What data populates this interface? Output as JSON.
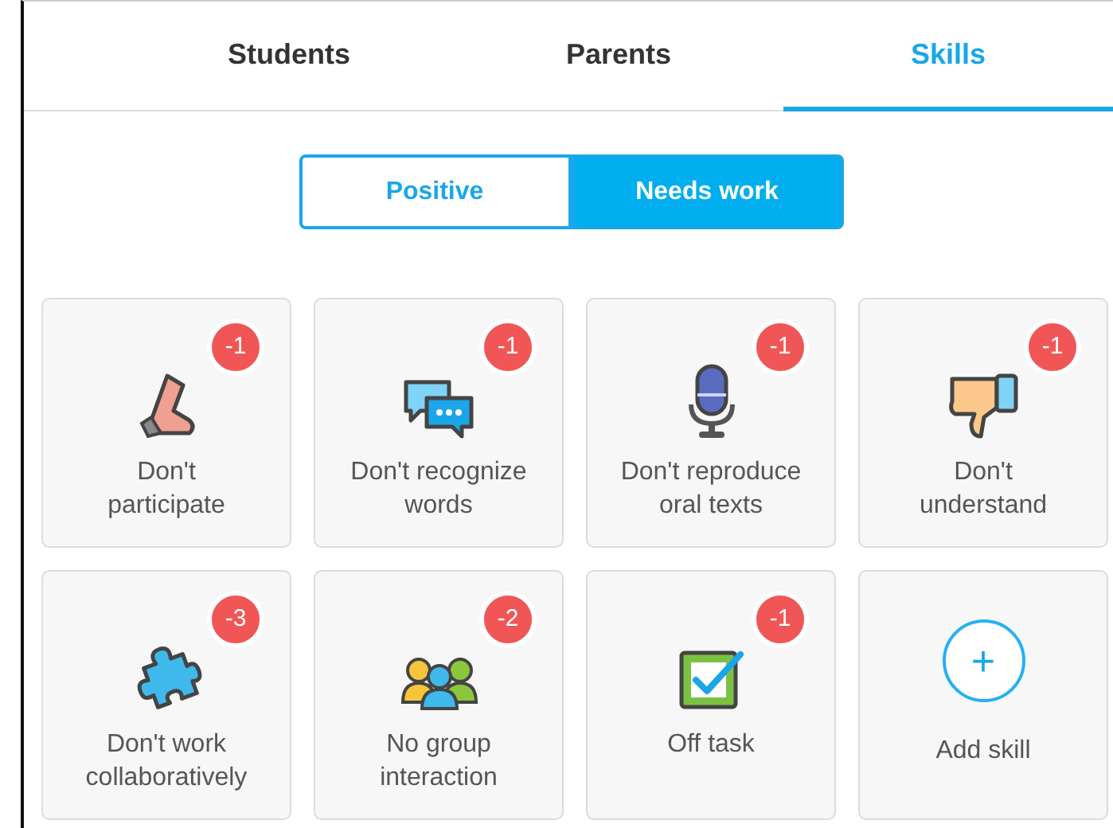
{
  "tabs": [
    {
      "label": "Students",
      "selected": false
    },
    {
      "label": "Parents",
      "selected": false
    },
    {
      "label": "Skills",
      "selected": true
    }
  ],
  "toggle": [
    {
      "label": "Positive",
      "selected": false
    },
    {
      "label": "Needs work",
      "selected": true
    }
  ],
  "tiles": [
    {
      "kind": "skill",
      "label": "Don't\nparticipate",
      "badge": "-1"
    },
    {
      "kind": "skill",
      "label": "Don't recognize\nwords",
      "badge": "-1"
    },
    {
      "kind": "skill",
      "label": "Don't reproduce\noral texts",
      "badge": "-1"
    },
    {
      "kind": "skill",
      "label": "Don't\nunderstand",
      "badge": "-1"
    },
    {
      "kind": "skill",
      "label": "Don't work\ncollaboratively",
      "badge": "-3"
    },
    {
      "kind": "skill",
      "label": "No group\ninteraction",
      "badge": "-2"
    },
    {
      "kind": "skill",
      "label": "Off task",
      "badge": "-1"
    },
    {
      "kind": "add",
      "label": "Add skill",
      "symbol": "+"
    }
  ]
}
